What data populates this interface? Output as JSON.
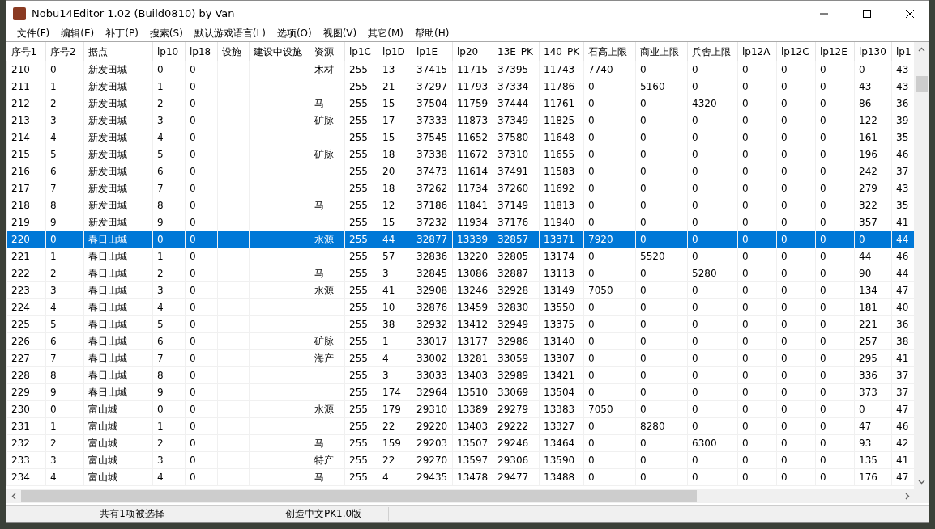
{
  "window": {
    "title": "Nobu14Editor 1.02 (Build0810) by Van"
  },
  "menu": [
    "文件(F)",
    "编辑(E)",
    "补丁(P)",
    "搜索(S)",
    "默认游戏语言(L)",
    "选项(O)",
    "视图(V)",
    "其它(M)",
    "帮助(H)"
  ],
  "table": {
    "columns": [
      "序号1",
      "序号2",
      "据点",
      "lp10",
      "lp18",
      "设施",
      "建设中设施",
      "资源",
      "lp1C",
      "lp1D",
      "lp1E",
      "lp20",
      "13E_PK",
      "140_PK",
      "石高上限",
      "商业上限",
      "兵舍上限",
      "lp12A",
      "lp12C",
      "lp12E",
      "lp130",
      "lp1"
    ],
    "rows": [
      {
        "selected": false,
        "cells": [
          "210",
          "0",
          "新发田城",
          "0",
          "0",
          null,
          null,
          "木材",
          "255",
          "13",
          "37415",
          "11715",
          "37395",
          "11743",
          "7740",
          "0",
          "0",
          "0",
          "0",
          "0",
          "0",
          "43"
        ]
      },
      {
        "selected": false,
        "cells": [
          "211",
          "1",
          "新发田城",
          "1",
          "0",
          null,
          null,
          null,
          "255",
          "21",
          "37297",
          "11793",
          "37334",
          "11786",
          "0",
          "5160",
          "0",
          "0",
          "0",
          "0",
          "43",
          "43"
        ]
      },
      {
        "selected": false,
        "cells": [
          "212",
          "2",
          "新发田城",
          "2",
          "0",
          null,
          null,
          "马",
          "255",
          "15",
          "37504",
          "11759",
          "37444",
          "11761",
          "0",
          "0",
          "4320",
          "0",
          "0",
          "0",
          "86",
          "36"
        ]
      },
      {
        "selected": false,
        "cells": [
          "213",
          "3",
          "新发田城",
          "3",
          "0",
          null,
          null,
          "矿脉",
          "255",
          "17",
          "37333",
          "11873",
          "37349",
          "11825",
          "0",
          "0",
          "0",
          "0",
          "0",
          "0",
          "122",
          "39"
        ]
      },
      {
        "selected": false,
        "cells": [
          "214",
          "4",
          "新发田城",
          "4",
          "0",
          null,
          null,
          null,
          "255",
          "15",
          "37545",
          "11652",
          "37580",
          "11648",
          "0",
          "0",
          "0",
          "0",
          "0",
          "0",
          "161",
          "35"
        ]
      },
      {
        "selected": false,
        "cells": [
          "215",
          "5",
          "新发田城",
          "5",
          "0",
          null,
          null,
          "矿脉",
          "255",
          "18",
          "37338",
          "11672",
          "37310",
          "11655",
          "0",
          "0",
          "0",
          "0",
          "0",
          "0",
          "196",
          "46"
        ]
      },
      {
        "selected": false,
        "cells": [
          "216",
          "6",
          "新发田城",
          "6",
          "0",
          null,
          null,
          null,
          "255",
          "20",
          "37473",
          "11614",
          "37491",
          "11583",
          "0",
          "0",
          "0",
          "0",
          "0",
          "0",
          "242",
          "37"
        ]
      },
      {
        "selected": false,
        "cells": [
          "217",
          "7",
          "新发田城",
          "7",
          "0",
          null,
          null,
          null,
          "255",
          "18",
          "37262",
          "11734",
          "37260",
          "11692",
          "0",
          "0",
          "0",
          "0",
          "0",
          "0",
          "279",
          "43"
        ]
      },
      {
        "selected": false,
        "cells": [
          "218",
          "8",
          "新发田城",
          "8",
          "0",
          null,
          null,
          "马",
          "255",
          "12",
          "37186",
          "11841",
          "37149",
          "11813",
          "0",
          "0",
          "0",
          "0",
          "0",
          "0",
          "322",
          "35"
        ]
      },
      {
        "selected": false,
        "cells": [
          "219",
          "9",
          "新发田城",
          "9",
          "0",
          null,
          null,
          null,
          "255",
          "15",
          "37232",
          "11934",
          "37176",
          "11940",
          "0",
          "0",
          "0",
          "0",
          "0",
          "0",
          "357",
          "41"
        ]
      },
      {
        "selected": true,
        "cells": [
          "220",
          "0",
          "春日山城",
          "0",
          "0",
          null,
          null,
          "水源",
          "255",
          "44",
          "32877",
          "13339",
          "32857",
          "13371",
          "7920",
          "0",
          "0",
          "0",
          "0",
          "0",
          "0",
          "44"
        ]
      },
      {
        "selected": false,
        "cells": [
          "221",
          "1",
          "春日山城",
          "1",
          "0",
          null,
          null,
          null,
          "255",
          "57",
          "32836",
          "13220",
          "32805",
          "13174",
          "0",
          "5520",
          "0",
          "0",
          "0",
          "0",
          "44",
          "46"
        ]
      },
      {
        "selected": false,
        "cells": [
          "222",
          "2",
          "春日山城",
          "2",
          "0",
          null,
          null,
          "马",
          "255",
          "3",
          "32845",
          "13086",
          "32887",
          "13113",
          "0",
          "0",
          "5280",
          "0",
          "0",
          "0",
          "90",
          "44"
        ]
      },
      {
        "selected": false,
        "cells": [
          "223",
          "3",
          "春日山城",
          "3",
          "0",
          null,
          null,
          "水源",
          "255",
          "41",
          "32908",
          "13246",
          "32928",
          "13149",
          "7050",
          "0",
          "0",
          "0",
          "0",
          "0",
          "134",
          "47"
        ]
      },
      {
        "selected": false,
        "cells": [
          "224",
          "4",
          "春日山城",
          "4",
          "0",
          null,
          null,
          null,
          "255",
          "10",
          "32876",
          "13459",
          "32830",
          "13550",
          "0",
          "0",
          "0",
          "0",
          "0",
          "0",
          "181",
          "40"
        ]
      },
      {
        "selected": false,
        "cells": [
          "225",
          "5",
          "春日山城",
          "5",
          "0",
          null,
          null,
          null,
          "255",
          "38",
          "32932",
          "13412",
          "32949",
          "13375",
          "0",
          "0",
          "0",
          "0",
          "0",
          "0",
          "221",
          "36"
        ]
      },
      {
        "selected": false,
        "cells": [
          "226",
          "6",
          "春日山城",
          "6",
          "0",
          null,
          null,
          "矿脉",
          "255",
          "1",
          "33017",
          "13177",
          "32986",
          "13140",
          "0",
          "0",
          "0",
          "0",
          "0",
          "0",
          "257",
          "38"
        ]
      },
      {
        "selected": false,
        "cells": [
          "227",
          "7",
          "春日山城",
          "7",
          "0",
          null,
          null,
          "海产",
          "255",
          "4",
          "33002",
          "13281",
          "33059",
          "13307",
          "0",
          "0",
          "0",
          "0",
          "0",
          "0",
          "295",
          "41"
        ]
      },
      {
        "selected": false,
        "cells": [
          "228",
          "8",
          "春日山城",
          "8",
          "0",
          null,
          null,
          null,
          "255",
          "3",
          "33033",
          "13403",
          "32989",
          "13421",
          "0",
          "0",
          "0",
          "0",
          "0",
          "0",
          "336",
          "37"
        ]
      },
      {
        "selected": false,
        "cells": [
          "229",
          "9",
          "春日山城",
          "9",
          "0",
          null,
          null,
          null,
          "255",
          "174",
          "32964",
          "13510",
          "33069",
          "13504",
          "0",
          "0",
          "0",
          "0",
          "0",
          "0",
          "373",
          "37"
        ]
      },
      {
        "selected": false,
        "cells": [
          "230",
          "0",
          "富山城",
          "0",
          "0",
          null,
          null,
          "水源",
          "255",
          "179",
          "29310",
          "13389",
          "29279",
          "13383",
          "7050",
          "0",
          "0",
          "0",
          "0",
          "0",
          "0",
          "47"
        ]
      },
      {
        "selected": false,
        "cells": [
          "231",
          "1",
          "富山城",
          "1",
          "0",
          null,
          null,
          null,
          "255",
          "22",
          "29220",
          "13403",
          "29222",
          "13327",
          "0",
          "8280",
          "0",
          "0",
          "0",
          "0",
          "47",
          "46"
        ]
      },
      {
        "selected": false,
        "cells": [
          "232",
          "2",
          "富山城",
          "2",
          "0",
          null,
          null,
          "马",
          "255",
          "159",
          "29203",
          "13507",
          "29246",
          "13464",
          "0",
          "0",
          "6300",
          "0",
          "0",
          "0",
          "93",
          "42"
        ]
      },
      {
        "selected": false,
        "cells": [
          "233",
          "3",
          "富山城",
          "3",
          "0",
          null,
          null,
          "特产",
          "255",
          "22",
          "29270",
          "13597",
          "29306",
          "13590",
          "0",
          "0",
          "0",
          "0",
          "0",
          "0",
          "135",
          "41"
        ]
      },
      {
        "selected": false,
        "cells": [
          "234",
          "4",
          "富山城",
          "4",
          "0",
          null,
          null,
          "马",
          "255",
          "4",
          "29435",
          "13478",
          "29477",
          "13488",
          "0",
          "0",
          "0",
          "0",
          "0",
          "0",
          "176",
          "47"
        ]
      }
    ]
  },
  "status_bar": [
    "共有1项被选择",
    "创造中文PK1.0版"
  ]
}
